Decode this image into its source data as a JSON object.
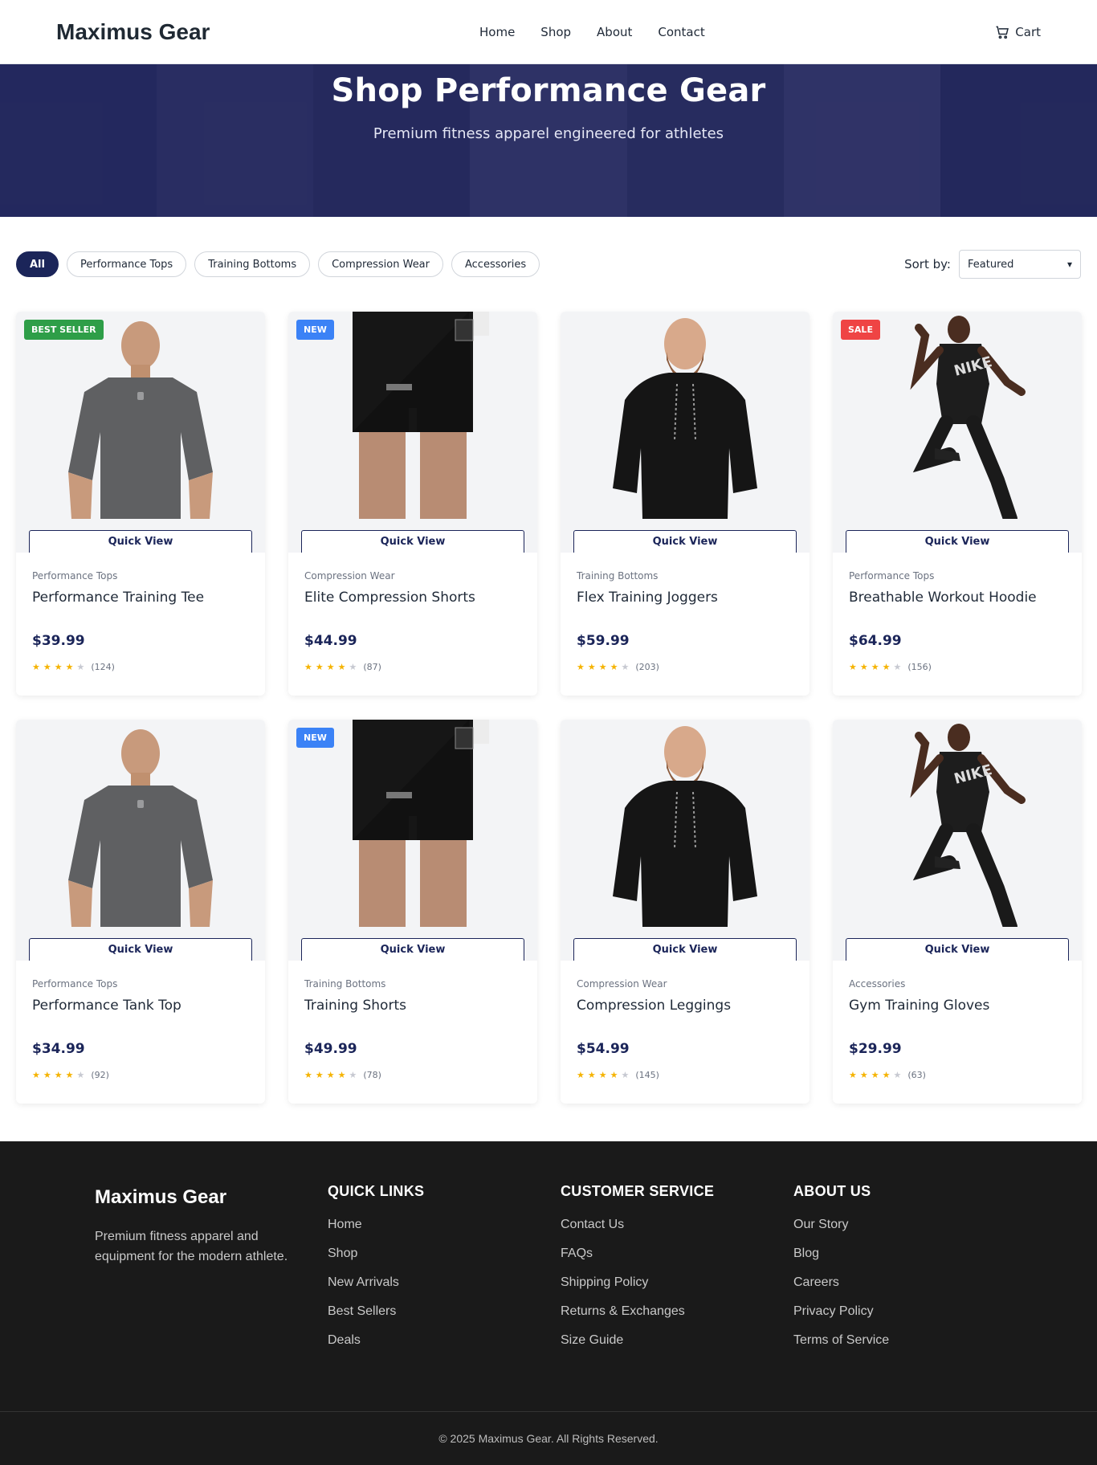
{
  "header": {
    "logo": "Maximus Gear",
    "nav": [
      "Home",
      "Shop",
      "About",
      "Contact"
    ],
    "cart_label": "Cart"
  },
  "hero": {
    "title": "Shop Performance Gear",
    "subtitle": "Premium fitness apparel engineered for athletes"
  },
  "filters": {
    "chips": [
      "All",
      "Performance Tops",
      "Training Bottoms",
      "Compression Wear",
      "Accessories"
    ],
    "active": "All",
    "sort_label": "Sort by:",
    "sort_value": "Featured"
  },
  "products": [
    {
      "badge": "BEST SELLER",
      "badge_color": "#2e9e48",
      "image": "grey-tee",
      "quick_view": "Quick View",
      "category": "Performance Tops",
      "name": "Performance Training Tee",
      "price": "$39.99",
      "rating": 4,
      "reviews": "(124)"
    },
    {
      "badge": "NEW",
      "badge_color": "#3b82f6",
      "image": "black-shorts",
      "quick_view": "Quick View",
      "category": "Compression Wear",
      "name": "Elite Compression Shorts",
      "price": "$44.99",
      "rating": 4,
      "reviews": "(87)"
    },
    {
      "badge": "",
      "badge_color": "",
      "image": "black-hoodie",
      "quick_view": "Quick View",
      "category": "Training Bottoms",
      "name": "Flex Training Joggers",
      "price": "$59.99",
      "rating": 4,
      "reviews": "(203)"
    },
    {
      "badge": "SALE",
      "badge_color": "#ef4444",
      "image": "running-athlete",
      "quick_view": "Quick View",
      "category": "Performance Tops",
      "name": "Breathable Workout Hoodie",
      "price": "$64.99",
      "rating": 4,
      "reviews": "(156)"
    },
    {
      "badge": "",
      "badge_color": "",
      "image": "grey-tee",
      "quick_view": "Quick View",
      "category": "Performance Tops",
      "name": "Performance Tank Top",
      "price": "$34.99",
      "rating": 4,
      "reviews": "(92)"
    },
    {
      "badge": "NEW",
      "badge_color": "#3b82f6",
      "image": "black-shorts",
      "quick_view": "Quick View",
      "category": "Training Bottoms",
      "name": "Training Shorts",
      "price": "$49.99",
      "rating": 4,
      "reviews": "(78)"
    },
    {
      "badge": "",
      "badge_color": "",
      "image": "black-hoodie",
      "quick_view": "Quick View",
      "category": "Compression Wear",
      "name": "Compression Leggings",
      "price": "$54.99",
      "rating": 4,
      "reviews": "(145)"
    },
    {
      "badge": "",
      "badge_color": "",
      "image": "running-athlete",
      "quick_view": "Quick View",
      "category": "Accessories",
      "name": "Gym Training Gloves",
      "price": "$29.99",
      "rating": 4,
      "reviews": "(63)"
    }
  ],
  "footer": {
    "brand": "Maximus Gear",
    "description": "Premium fitness apparel and equipment for the modern athlete.",
    "columns": [
      {
        "heading": "QUICK LINKS",
        "links": [
          "Home",
          "Shop",
          "New Arrivals",
          "Best Sellers",
          "Deals"
        ]
      },
      {
        "heading": "CUSTOMER SERVICE",
        "links": [
          "Contact Us",
          "FAQs",
          "Shipping Policy",
          "Returns & Exchanges",
          "Size Guide"
        ]
      },
      {
        "heading": "ABOUT US",
        "links": [
          "Our Story",
          "Blog",
          "Careers",
          "Privacy Policy",
          "Terms of Service"
        ]
      }
    ],
    "copyright": "© 2025 Maximus Gear. All Rights Reserved."
  },
  "colors": {
    "primary": "#1b2559",
    "star": "#f5b301",
    "footer_bg": "#1a1a1a"
  }
}
